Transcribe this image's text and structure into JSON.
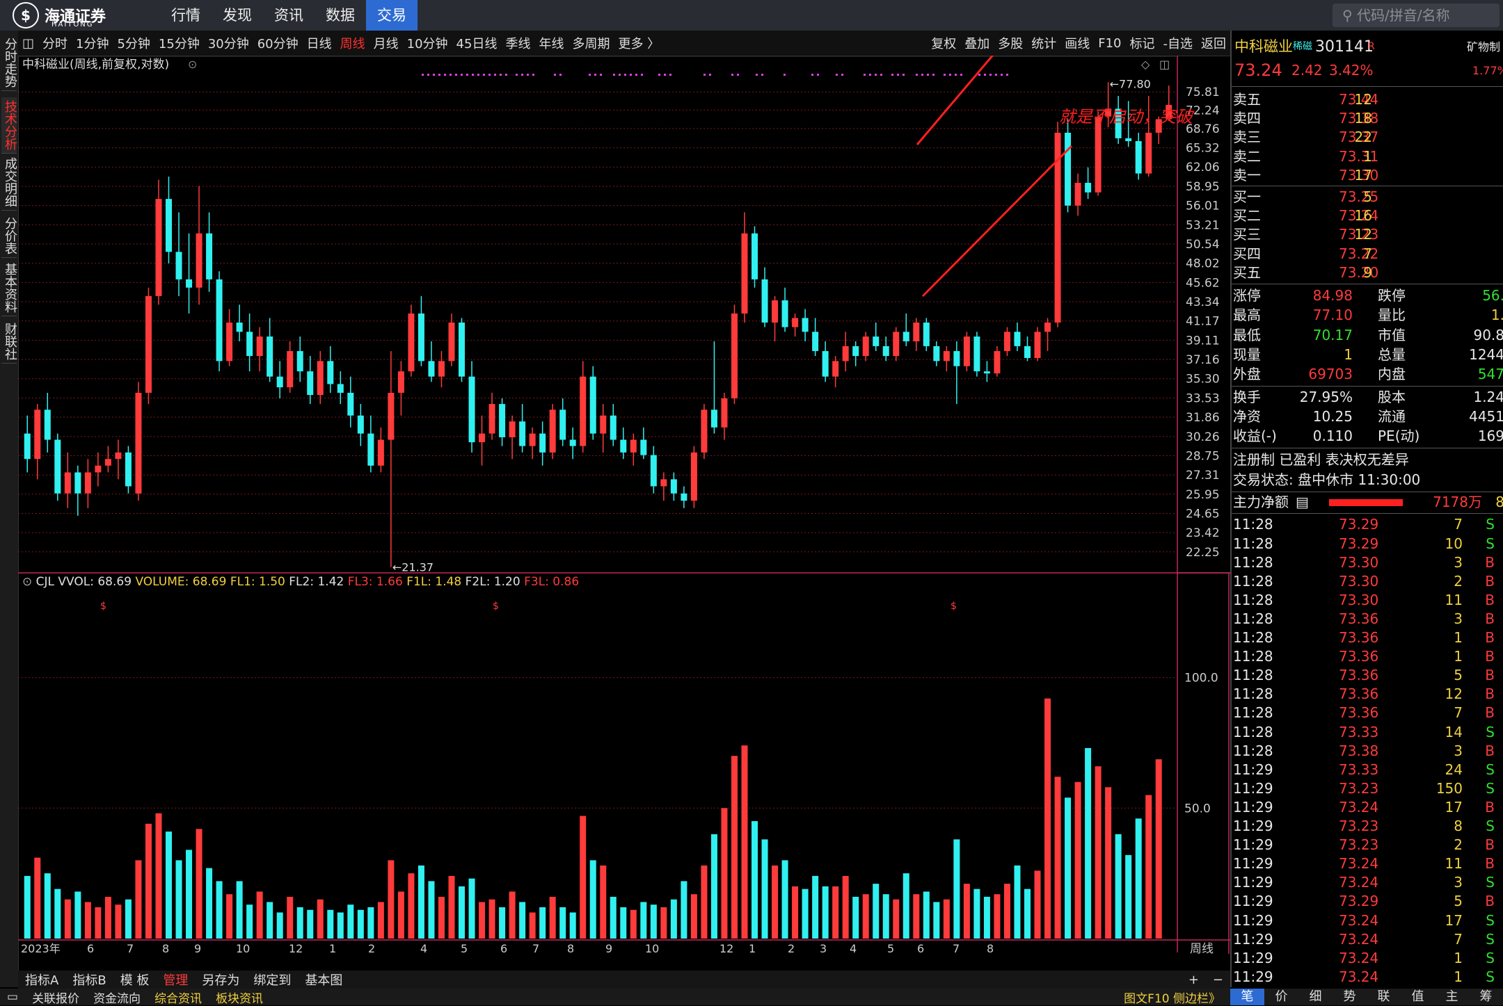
{
  "topbar": {
    "logo_text": "海通证券",
    "logo_sub": "HAITONG",
    "menu": [
      "行情",
      "发现",
      "资讯",
      "数据",
      "交易"
    ],
    "active_menu": "交易",
    "search_placeholder": "代码/拼音/名称"
  },
  "left_tabs": [
    "分时走势",
    "技术分析",
    "成交明细",
    "分价表",
    "基本资料",
    "财联社"
  ],
  "left_tab_active": "技术分析",
  "toolbar": {
    "periods": [
      "分时",
      "1分钟",
      "5分钟",
      "15分钟",
      "30分钟",
      "60分钟",
      "日线",
      "周线",
      "月线",
      "10分钟",
      "45日线",
      "季线",
      "年线",
      "多周期",
      "更多 〉"
    ],
    "active_period": "周线",
    "right": [
      "复权",
      "叠加",
      "多股",
      "统计",
      "画线",
      "F10",
      "标记",
      "-自选",
      "返回"
    ]
  },
  "chart": {
    "title": "中科磁业(周线,前复权,对数)",
    "annotation": "就是不启动，突破",
    "high_label": "77.80",
    "low_label": "21.37",
    "period_label": "周线",
    "volume_legend": [
      {
        "text": "CJL",
        "color": "#e0e0e0"
      },
      {
        "text": "VVOL: 68.69",
        "color": "#e0e0e0"
      },
      {
        "text": "VOLUME: 68.69",
        "color": "#f0d040"
      },
      {
        "text": "FL1: 1.50",
        "color": "#f0d040"
      },
      {
        "text": "FL2: 1.42",
        "color": "#e0e0e0"
      },
      {
        "text": "FL3: 1.66",
        "color": "#ff3b3b"
      },
      {
        "text": "F1L: 1.48",
        "color": "#f0d040"
      },
      {
        "text": "F2L: 1.20",
        "color": "#e0e0e0"
      },
      {
        "text": "F3L: 0.86",
        "color": "#ff3b3b"
      }
    ]
  },
  "chart_data": {
    "type": "candlestick",
    "y_scale": "log",
    "y_ticks": [
      75.81,
      72.24,
      68.76,
      65.32,
      62.06,
      58.95,
      56.01,
      53.21,
      50.54,
      48.02,
      45.62,
      43.34,
      41.17,
      39.11,
      37.16,
      35.3,
      33.53,
      31.86,
      30.26,
      28.75,
      27.31,
      25.95,
      24.65,
      23.42,
      22.25
    ],
    "volume_ticks": [
      100.0,
      50.0
    ],
    "x_labels": [
      "2023年",
      "6",
      "7",
      "8",
      "9",
      "10",
      "12",
      "1",
      "2",
      "4",
      "5",
      "6",
      "7",
      "8",
      "9",
      "10",
      "12",
      "1",
      "2",
      "3",
      "4",
      "5",
      "6",
      "7",
      "8"
    ],
    "candles_ohlc": [
      [
        30.5,
        32.0,
        27.5,
        28.5
      ],
      [
        28.5,
        33.0,
        27.0,
        32.5
      ],
      [
        32.5,
        34.0,
        29.0,
        30.0
      ],
      [
        30.0,
        30.5,
        25.5,
        26.0
      ],
      [
        26.0,
        29.0,
        25.0,
        27.5
      ],
      [
        27.5,
        28.0,
        24.5,
        26.0
      ],
      [
        26.0,
        28.5,
        25.0,
        27.5
      ],
      [
        27.5,
        29.0,
        26.5,
        28.0
      ],
      [
        28.0,
        29.5,
        27.5,
        28.5
      ],
      [
        28.5,
        30.0,
        27.0,
        29.0
      ],
      [
        29.0,
        29.5,
        26.0,
        26.5
      ],
      [
        26.0,
        35.0,
        25.5,
        34.0
      ],
      [
        34.0,
        45.0,
        33.0,
        44.0
      ],
      [
        44.0,
        60.0,
        43.0,
        57.0
      ],
      [
        57.0,
        60.5,
        48.0,
        49.5
      ],
      [
        49.5,
        55.0,
        44.0,
        46.0
      ],
      [
        46.0,
        52.0,
        42.0,
        45.0
      ],
      [
        45.0,
        59.0,
        43.0,
        52.0
      ],
      [
        52.0,
        55.0,
        44.5,
        46.0
      ],
      [
        46.0,
        47.0,
        36.0,
        37.0
      ],
      [
        37.0,
        42.5,
        36.5,
        41.0
      ],
      [
        41.0,
        43.0,
        39.0,
        40.0
      ],
      [
        40.0,
        42.0,
        36.0,
        37.5
      ],
      [
        37.5,
        40.5,
        36.0,
        39.5
      ],
      [
        39.5,
        41.5,
        35.0,
        35.5
      ],
      [
        35.5,
        37.0,
        33.5,
        34.5
      ],
      [
        34.5,
        39.0,
        34.0,
        38.0
      ],
      [
        38.0,
        39.5,
        35.0,
        36.0
      ],
      [
        36.0,
        37.5,
        33.0,
        33.8
      ],
      [
        33.8,
        38.0,
        33.0,
        37.0
      ],
      [
        37.0,
        38.5,
        34.0,
        34.8
      ],
      [
        34.8,
        36.0,
        33.0,
        34.0
      ],
      [
        34.0,
        35.5,
        31.0,
        32.0
      ],
      [
        32.0,
        33.0,
        29.5,
        30.5
      ],
      [
        30.5,
        32.0,
        27.5,
        28.0
      ],
      [
        28.0,
        31.0,
        27.5,
        30.0
      ],
      [
        30.0,
        38.0,
        21.37,
        34.0
      ],
      [
        34.0,
        37.0,
        32.0,
        36.0
      ],
      [
        36.0,
        43.0,
        35.5,
        42.0
      ],
      [
        42.0,
        44.0,
        36.5,
        37.0
      ],
      [
        37.0,
        39.0,
        35.0,
        35.5
      ],
      [
        35.5,
        38.0,
        34.5,
        37.0
      ],
      [
        37.0,
        42.0,
        36.5,
        41.0
      ],
      [
        41.0,
        41.5,
        35.0,
        35.5
      ],
      [
        35.5,
        37.0,
        29.0,
        29.8
      ],
      [
        29.8,
        32.0,
        28.0,
        30.5
      ],
      [
        30.5,
        34.0,
        30.0,
        33.0
      ],
      [
        33.0,
        33.5,
        29.5,
        30.2
      ],
      [
        30.2,
        32.0,
        28.5,
        31.5
      ],
      [
        31.5,
        33.0,
        29.0,
        29.5
      ],
      [
        29.5,
        31.0,
        28.5,
        30.5
      ],
      [
        30.5,
        31.5,
        28.0,
        29.0
      ],
      [
        29.0,
        33.0,
        28.5,
        32.5
      ],
      [
        32.5,
        33.5,
        29.5,
        30.0
      ],
      [
        30.0,
        31.0,
        28.5,
        29.5
      ],
      [
        29.5,
        37.0,
        29.0,
        35.5
      ],
      [
        35.5,
        36.5,
        30.0,
        30.5
      ],
      [
        30.5,
        33.0,
        29.0,
        32.0
      ],
      [
        32.0,
        33.0,
        29.5,
        30.0
      ],
      [
        30.0,
        31.0,
        28.5,
        29.0
      ],
      [
        29.0,
        30.5,
        28.0,
        30.0
      ],
      [
        30.0,
        31.0,
        28.5,
        28.8
      ],
      [
        28.8,
        29.5,
        26.0,
        26.5
      ],
      [
        26.5,
        27.5,
        25.5,
        27.0
      ],
      [
        27.0,
        27.5,
        25.5,
        26.0
      ],
      [
        26.0,
        26.5,
        25.0,
        25.5
      ],
      [
        25.5,
        29.5,
        25.0,
        29.0
      ],
      [
        29.0,
        33.0,
        28.5,
        32.5
      ],
      [
        32.5,
        39.0,
        30.5,
        31.0
      ],
      [
        31.0,
        34.0,
        30.0,
        33.5
      ],
      [
        33.5,
        43.0,
        33.0,
        42.0
      ],
      [
        42.0,
        55.0,
        41.0,
        52.0
      ],
      [
        52.0,
        53.0,
        45.0,
        46.0
      ],
      [
        46.0,
        47.5,
        40.5,
        41.0
      ],
      [
        41.0,
        44.0,
        39.0,
        43.5
      ],
      [
        43.5,
        45.0,
        40.0,
        40.5
      ],
      [
        40.5,
        42.0,
        39.5,
        41.5
      ],
      [
        41.5,
        42.5,
        39.0,
        40.0
      ],
      [
        40.0,
        41.5,
        37.5,
        38.0
      ],
      [
        38.0,
        39.0,
        35.0,
        35.5
      ],
      [
        35.5,
        37.5,
        34.5,
        37.0
      ],
      [
        37.0,
        40.0,
        36.0,
        38.5
      ],
      [
        38.5,
        39.0,
        36.5,
        37.5
      ],
      [
        37.5,
        40.0,
        37.0,
        39.5
      ],
      [
        39.5,
        41.0,
        38.0,
        38.5
      ],
      [
        38.5,
        39.5,
        37.0,
        37.5
      ],
      [
        37.5,
        40.5,
        37.0,
        40.0
      ],
      [
        40.0,
        42.0,
        38.5,
        39.0
      ],
      [
        39.0,
        41.5,
        38.0,
        41.0
      ],
      [
        41.0,
        41.5,
        38.0,
        38.5
      ],
      [
        38.5,
        39.0,
        36.5,
        37.0
      ],
      [
        37.0,
        38.5,
        36.0,
        38.0
      ],
      [
        38.0,
        39.0,
        33.0,
        36.5
      ],
      [
        36.5,
        40.0,
        36.0,
        39.5
      ],
      [
        39.5,
        40.0,
        35.5,
        36.0
      ],
      [
        36.0,
        37.0,
        35.0,
        35.8
      ],
      [
        35.8,
        38.5,
        35.5,
        38.0
      ],
      [
        38.0,
        40.5,
        37.5,
        40.0
      ],
      [
        40.0,
        41.0,
        38.0,
        38.5
      ],
      [
        38.5,
        39.5,
        37.0,
        37.3
      ],
      [
        37.3,
        40.5,
        37.0,
        40.0
      ],
      [
        40.0,
        41.5,
        38.0,
        41.0
      ],
      [
        41.0,
        70.0,
        40.5,
        68.0
      ],
      [
        68.0,
        70.5,
        55.0,
        56.0
      ],
      [
        56.0,
        61.0,
        54.5,
        59.5
      ],
      [
        59.5,
        62.0,
        57.0,
        58.0
      ],
      [
        58.0,
        72.0,
        57.5,
        71.0
      ],
      [
        71.0,
        77.8,
        69.0,
        72.5
      ],
      [
        72.5,
        75.0,
        66.0,
        67.0
      ],
      [
        67.0,
        74.0,
        65.5,
        66.5
      ],
      [
        66.5,
        68.0,
        60.0,
        61.0
      ],
      [
        61.0,
        75.0,
        60.5,
        68.0
      ],
      [
        68.0,
        71.0,
        66.0,
        70.5
      ],
      [
        70.5,
        77.1,
        70.17,
        73.24
      ]
    ],
    "volumes": [
      24,
      31,
      25,
      19,
      15,
      18,
      14,
      12,
      16,
      13,
      15,
      30,
      44,
      48,
      41,
      30,
      34,
      42,
      27,
      22,
      17,
      22,
      13,
      18,
      14,
      10,
      16,
      12,
      11,
      15,
      11,
      10,
      13,
      11,
      12,
      14,
      30,
      18,
      25,
      28,
      22,
      16,
      24,
      20,
      23,
      14,
      15,
      12,
      18,
      14,
      10,
      12,
      16,
      12,
      10,
      47,
      30,
      28,
      16,
      12,
      11,
      14,
      13,
      12,
      15,
      22,
      17,
      28,
      40,
      50,
      70,
      74,
      45,
      38,
      28,
      30,
      20,
      19,
      24,
      20,
      20,
      24,
      16,
      17,
      21,
      17,
      15,
      25,
      17,
      18,
      14,
      15,
      38,
      21,
      19,
      16,
      17,
      21,
      28,
      19,
      26,
      92,
      62,
      54,
      60,
      73,
      66,
      58,
      40,
      32,
      46,
      55,
      68.69
    ],
    "price_colors": {
      "up": "#ff3b3b",
      "down": "#30f0f0"
    }
  },
  "quote": {
    "name": "中科磁业",
    "tag": "稀磁",
    "code": "301141",
    "suffix": "R",
    "side_label": "矿物制",
    "side_value": "1.77%",
    "price": "73.24",
    "change": "2.42",
    "pct": "3.42%",
    "asks": [
      [
        "卖五",
        "73.44",
        "12"
      ],
      [
        "卖四",
        "73.38",
        "18"
      ],
      [
        "卖三",
        "73.37",
        "22"
      ],
      [
        "卖二",
        "73.31",
        "1"
      ],
      [
        "卖一",
        "73.30",
        "17"
      ]
    ],
    "bids": [
      [
        "买一",
        "73.25",
        "5"
      ],
      [
        "买二",
        "73.24",
        "16"
      ],
      [
        "买三",
        "73.23",
        "12"
      ],
      [
        "买四",
        "73.22",
        "7"
      ],
      [
        "买五",
        "73.20",
        "9"
      ]
    ],
    "stats": [
      [
        "涨停",
        "84.98",
        "跌停",
        "56."
      ],
      [
        "最高",
        "77.10",
        "量比",
        "1."
      ],
      [
        "最低",
        "70.17",
        "市值",
        "90.8"
      ],
      [
        "现量",
        "1",
        "总量",
        "1244"
      ],
      [
        "外盘",
        "69703",
        "内盘",
        "547"
      ],
      [
        "换手",
        "27.95%",
        "股本",
        "1.24"
      ],
      [
        "净资",
        "10.25",
        "流通",
        "4451"
      ],
      [
        "收益(-)",
        "0.110",
        "PE(动)",
        "169"
      ]
    ],
    "info1": "注册制 已盈利 表决权无差异",
    "info2": "交易状态: 盘中休市 11:30:00",
    "flow_label": "主力净额",
    "flow_value": "7178万",
    "flow_extra": "8",
    "ticks": [
      [
        "11:28",
        "73.29",
        "7",
        "S"
      ],
      [
        "11:28",
        "73.29",
        "10",
        "S"
      ],
      [
        "11:28",
        "73.30",
        "3",
        "B"
      ],
      [
        "11:28",
        "73.30",
        "2",
        "B"
      ],
      [
        "11:28",
        "73.30",
        "11",
        "B"
      ],
      [
        "11:28",
        "73.36",
        "3",
        "B"
      ],
      [
        "11:28",
        "73.36",
        "1",
        "B"
      ],
      [
        "11:28",
        "73.36",
        "1",
        "B"
      ],
      [
        "11:28",
        "73.36",
        "5",
        "B"
      ],
      [
        "11:28",
        "73.36",
        "12",
        "B"
      ],
      [
        "11:28",
        "73.36",
        "7",
        "B"
      ],
      [
        "11:28",
        "73.33",
        "14",
        "S"
      ],
      [
        "11:28",
        "73.38",
        "3",
        "B"
      ],
      [
        "11:29",
        "73.33",
        "24",
        "S"
      ],
      [
        "11:29",
        "73.23",
        "150",
        "S"
      ],
      [
        "11:29",
        "73.24",
        "17",
        "B"
      ],
      [
        "11:29",
        "73.23",
        "8",
        "S"
      ],
      [
        "11:29",
        "73.23",
        "2",
        "B"
      ],
      [
        "11:29",
        "73.24",
        "11",
        "B"
      ],
      [
        "11:29",
        "73.24",
        "3",
        "S"
      ],
      [
        "11:29",
        "73.29",
        "5",
        "B"
      ],
      [
        "11:29",
        "73.24",
        "17",
        "S"
      ],
      [
        "11:29",
        "73.24",
        "7",
        "S"
      ],
      [
        "11:29",
        "73.24",
        "1",
        "S"
      ],
      [
        "11:29",
        "73.24",
        "1",
        "S"
      ]
    ]
  },
  "bottom": {
    "row1": [
      "指标A",
      "指标B",
      "模 板",
      "管理",
      "另存为",
      "绑定到",
      "基本图"
    ],
    "row1_selected": "管理",
    "row1_right": [
      "+",
      "−"
    ],
    "row2": [
      "关联报价",
      "资金流向",
      "综合资讯",
      "板块资讯"
    ],
    "row2_highlight": [
      "综合资讯",
      "板块资讯"
    ],
    "row2_right": "图文F10 侧边栏》",
    "right_tabs": [
      "笔",
      "价",
      "细",
      "势",
      "联",
      "值",
      "主",
      "筹"
    ]
  }
}
